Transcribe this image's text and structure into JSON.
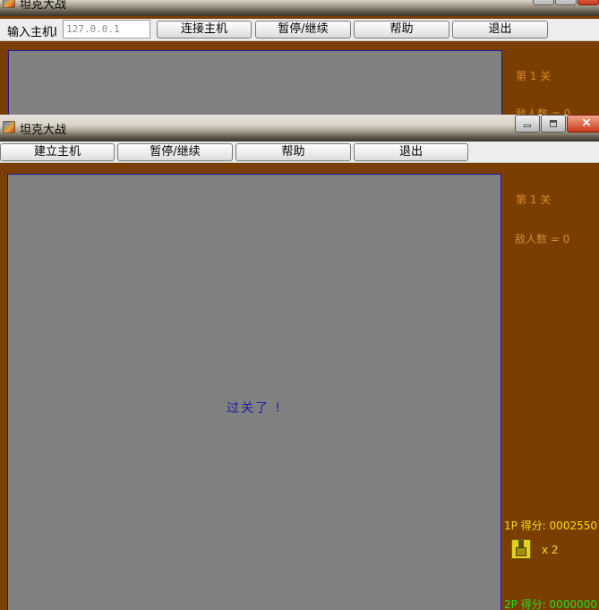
{
  "back_window": {
    "title": "坦克大战",
    "host_label": "输入主机I",
    "host_value": "127.0.0.1",
    "buttons": [
      "连接主机",
      "暂停/继续",
      "帮助",
      "退出"
    ],
    "level_text": "第 1 关",
    "enemy_text_partial": "敌人数 = 0"
  },
  "front_window": {
    "title": "坦克大战",
    "buttons": [
      "建立主机",
      "暂停/继续",
      "帮助",
      "退出"
    ],
    "center_message": "过关了 !",
    "level_text": "第 1 关",
    "enemy_text": "敌人数 = 0",
    "score_1p": "1P 得分: 0002550",
    "lives_text": "x 2",
    "score_2p": "2P 得分: 0000000"
  },
  "colors": {
    "background": "#7a3e00",
    "playfield": "#808080",
    "score_1p": "#f0e000",
    "score_2p": "#20e020",
    "message": "#2020a0"
  }
}
